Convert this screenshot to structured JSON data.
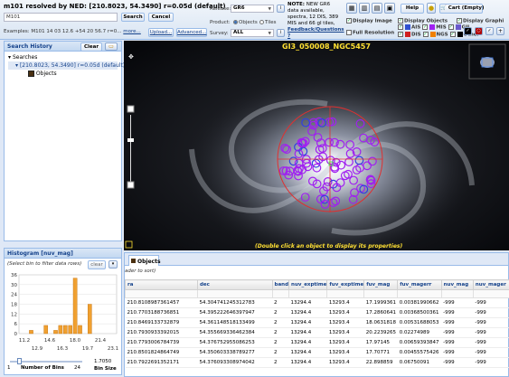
{
  "app": {
    "title": "m101 resolved by NED: [210.8023, 54.3490] r=0.05d (default)"
  },
  "search": {
    "value": "M101",
    "search_label": "Search",
    "cancel_label": "Cancel",
    "examples_label": "Examples:",
    "examples_text": "M101  14 03 12.6 +54 20 56.7 r=0...",
    "more_label": "more...",
    "upload_label": "Upload...",
    "advanced_label": "Advanced..."
  },
  "release": {
    "label": "Release:",
    "value": "GR6"
  },
  "product": {
    "label": "Product:",
    "options": [
      "Objects",
      "Tiles"
    ],
    "selected": "Objects"
  },
  "survey": {
    "label": "Survey:",
    "value": "ALL"
  },
  "note": {
    "prefix": "NOTE:",
    "text": "NEW GR6 data available, spectra, 12 DIS, 389 MIS and 66 gI tiles,",
    "link": "Feedback/Questions ?"
  },
  "toolbar": {
    "help_label": "Help",
    "cart_label": "Cart (Empty)",
    "display_image": "Display Image",
    "full_resolution": "Full Resolution",
    "display_objects": "Display Objects",
    "display_graphics": "Display Graphi",
    "cat_ais": "AIS",
    "cat_mis": "MIS",
    "cat_gii": "GII",
    "cat_dis": "DIS",
    "cat_ngs": "NGS",
    "cat_other": "Other"
  },
  "history": {
    "title": "Search History",
    "clear_label": "Clear",
    "root_label": "Searches",
    "search_item": "[210.8023, 54.3490] r=0.05d (default)",
    "objects_label": "Objects"
  },
  "histogram": {
    "title": "Histogram [nuv_mag]",
    "hint": "(Select bin to filter data rows)",
    "clear_label": "clear",
    "num_bins_label": "Number of Bins",
    "num_bins_value": "24",
    "bin_min_label": "1",
    "bin_size_label": "Bin Size",
    "bin_size_value": "1.7050"
  },
  "chart_data": {
    "type": "bar",
    "title": "",
    "xlabel": "",
    "ylabel": "",
    "ylim": [
      0,
      36
    ],
    "yticks": [
      0,
      6,
      12,
      18,
      24,
      30,
      36
    ],
    "xticks_top": [
      "11.2",
      "14.6",
      "18.0",
      "21.4"
    ],
    "xticks_bottom": [
      "12.9",
      "16.3",
      "19.7",
      "23.1"
    ],
    "values": [
      0,
      0,
      2,
      0,
      0,
      5,
      0,
      2,
      5,
      5,
      5,
      34,
      5,
      0,
      18,
      0,
      0,
      0,
      0,
      0
    ],
    "bar_color": "#f0a030"
  },
  "viewer": {
    "title": "GI3_050008_NGC5457",
    "hint": "(Double click an object to display its properties)"
  },
  "objects": {
    "tab_label": "Objects",
    "sort_hint": "ader to sort)",
    "columns": [
      "ra",
      "dec",
      "band",
      "nuv_exptime",
      "fuv_exptime",
      "fuv_mag",
      "fuv_magerr",
      "nuv_mag",
      "nuv_mager"
    ],
    "rows": [
      [
        "210.8108987361457",
        "54.304741245312783",
        "2",
        "13294.4",
        "13293.4",
        "17.1999361",
        "0.00381990662",
        "-999",
        "-999"
      ],
      [
        "210.7703188736851",
        "54.395222646397947",
        "2",
        "13294.4",
        "13293.4",
        "17.2860641",
        "0.00368500361",
        "-999",
        "-999"
      ],
      [
        "210.8469133732879",
        "54.361148518133499",
        "2",
        "13294.4",
        "13293.4",
        "18.0631818",
        "0.00531688053",
        "-999",
        "-999"
      ],
      [
        "210.7930933392015",
        "54.355669336462384",
        "2",
        "13294.4",
        "13293.4",
        "20.2239265",
        "0.02274989",
        "-999",
        "-999"
      ],
      [
        "210.7793006784739",
        "54.376752955086253",
        "2",
        "13294.4",
        "13293.4",
        "17.97145",
        "0.00659393847",
        "-999",
        "-999"
      ],
      [
        "210.8501824864749",
        "54.350603338789277",
        "2",
        "13294.4",
        "13293.4",
        "17.70771",
        "0.00455575426",
        "-999",
        "-999"
      ],
      [
        "210.7922691352171",
        "54.376093308974042",
        "2",
        "13294.4",
        "13293.4",
        "22.898859",
        "0.06750091",
        "-999",
        "-999"
      ]
    ]
  }
}
